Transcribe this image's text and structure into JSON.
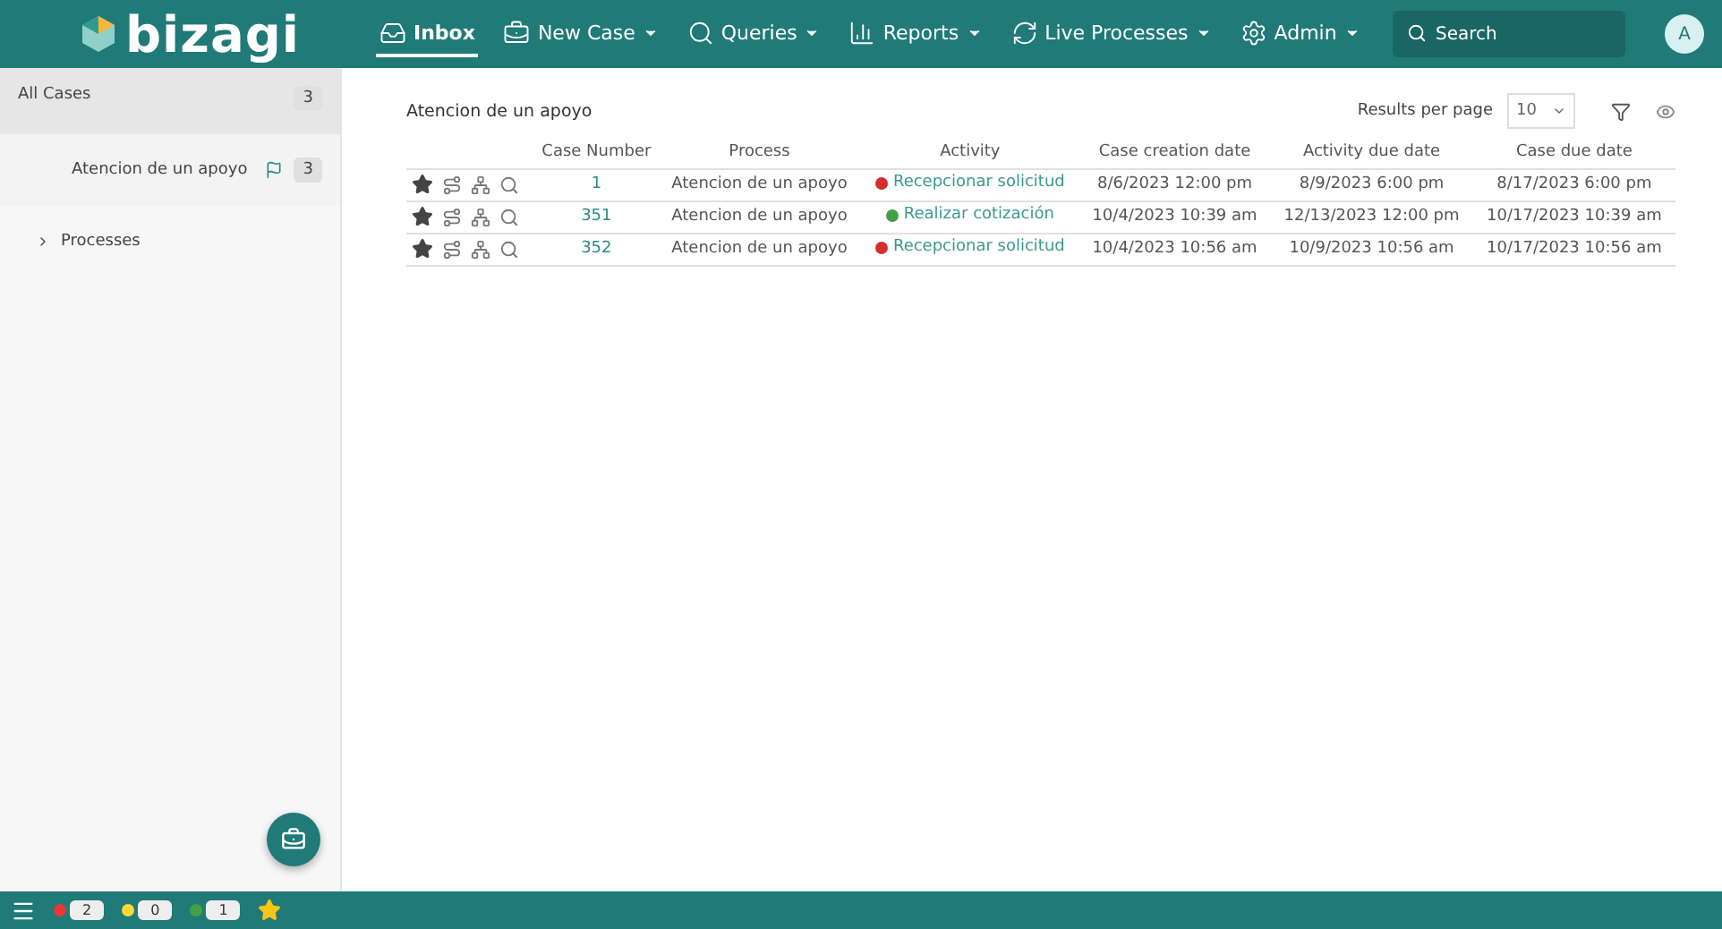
{
  "header": {
    "logo": "bizagi",
    "nav": [
      {
        "label": "Inbox",
        "dropdown": false,
        "selected": true
      },
      {
        "label": "New Case",
        "dropdown": true,
        "selected": false
      },
      {
        "label": "Queries",
        "dropdown": true,
        "selected": false
      },
      {
        "label": "Reports",
        "dropdown": true,
        "selected": false
      },
      {
        "label": "Live Processes",
        "dropdown": true,
        "selected": false
      },
      {
        "label": "Admin",
        "dropdown": true,
        "selected": false
      }
    ],
    "search": {
      "placeholder": "Search"
    },
    "avatar": "A"
  },
  "sidebar": {
    "items": [
      {
        "label": "All Cases",
        "count": "3",
        "selected": true,
        "kind": "group"
      },
      {
        "label": "Atencion de un apoyo",
        "count": "3",
        "selected": false,
        "kind": "process"
      },
      {
        "label": "Processes",
        "selected": false,
        "kind": "folder"
      }
    ]
  },
  "content": {
    "title": "Atencion de un apoyo",
    "results_label": "Results per page",
    "results_value": "10",
    "table": {
      "columns": [
        "Case Number",
        "Process",
        "Activity",
        "Case creation date",
        "Activity due date",
        "Case due date"
      ],
      "rows": [
        {
          "case": "1",
          "process": "Atencion de un apoyo",
          "activity": "Recepcionar solicitud",
          "color": "#d32f2f",
          "created": "8/6/2023 12:00 pm",
          "activity_due": "8/9/2023 6:00 pm",
          "case_due": "8/17/2023 6:00 pm"
        },
        {
          "case": "351",
          "process": "Atencion de un apoyo",
          "activity": "Realizar cotización",
          "color": "#43a047",
          "created": "10/4/2023 10:39 am",
          "activity_due": "12/13/2023 12:00 pm",
          "case_due": "10/17/2023 10:39 am"
        },
        {
          "case": "352",
          "process": "Atencion de un apoyo",
          "activity": "Recepcionar solicitud",
          "color": "#d32f2f",
          "created": "10/4/2023 10:56 am",
          "activity_due": "10/9/2023 10:56 am",
          "case_due": "10/17/2023 10:56 am"
        }
      ]
    }
  },
  "status_bar": {
    "counters": [
      {
        "count": "2",
        "color": "#e53935"
      },
      {
        "count": "0",
        "color": "#fdd835"
      },
      {
        "count": "1",
        "color": "#43a047"
      }
    ]
  }
}
